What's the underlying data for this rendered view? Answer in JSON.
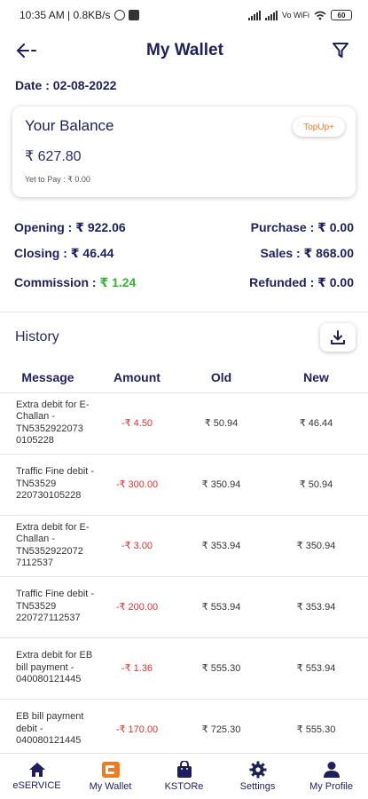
{
  "status_bar": {
    "time": "10:35 AM | 0.8KB/s",
    "network": "Vo WiFi",
    "battery": "60"
  },
  "header": {
    "title": "My Wallet"
  },
  "date_line": "Date : 02-08-2022",
  "balance_card": {
    "title": "Your Balance",
    "amount": "₹ 627.80",
    "yet_to_pay": "Yet to Pay : ₹ 0.00",
    "topup_label": "TopUp+"
  },
  "summary": {
    "opening": "Opening : ₹ 922.06",
    "purchase": "Purchase : ₹ 0.00",
    "closing": "Closing : ₹ 46.44",
    "sales": "Sales : ₹ 868.00",
    "commission_label": "Commission : ",
    "commission_value": "₹ 1.24",
    "refunded": "Refunded : ₹ 0.00"
  },
  "history": {
    "title": "History",
    "columns": [
      "Message",
      "Amount",
      "Old",
      "New"
    ],
    "rows": [
      {
        "message": "Extra debit for E-Challan - TN5352922073 0105228",
        "amount": "-₹ 4.50",
        "old": "₹ 50.94",
        "new": "₹ 46.44"
      },
      {
        "message": "Traffic Fine debit - TN53529 220730105228",
        "amount": "-₹ 300.00",
        "old": "₹ 350.94",
        "new": "₹ 50.94"
      },
      {
        "message": "Extra debit for E-Challan - TN5352922072 7112537",
        "amount": "-₹ 3.00",
        "old": "₹ 353.94",
        "new": "₹ 350.94"
      },
      {
        "message": "Traffic Fine debit - TN53529 220727112537",
        "amount": "-₹ 200.00",
        "old": "₹ 553.94",
        "new": "₹ 353.94"
      },
      {
        "message": "Extra debit for EB bill payment - 040080121445",
        "amount": "-₹ 1.36",
        "old": "₹ 555.30",
        "new": "₹ 553.94"
      },
      {
        "message": "EB bill payment debit - 040080121445",
        "amount": "-₹ 170.00",
        "old": "₹ 725.30",
        "new": "₹ 555.30"
      }
    ]
  },
  "bottom_nav": {
    "items": [
      {
        "label": "eSERVICE",
        "icon": "home-icon"
      },
      {
        "label": "My Wallet",
        "icon": "wallet-icon"
      },
      {
        "label": "KSTORe",
        "icon": "shopping-bag-icon"
      },
      {
        "label": "Settings",
        "icon": "gear-icon"
      },
      {
        "label": "My Profile",
        "icon": "person-icon"
      }
    ]
  },
  "colors": {
    "primary": "#1f1f5c",
    "negative": "#e03030",
    "positive": "#2fb82f",
    "accent": "#f07a22"
  }
}
